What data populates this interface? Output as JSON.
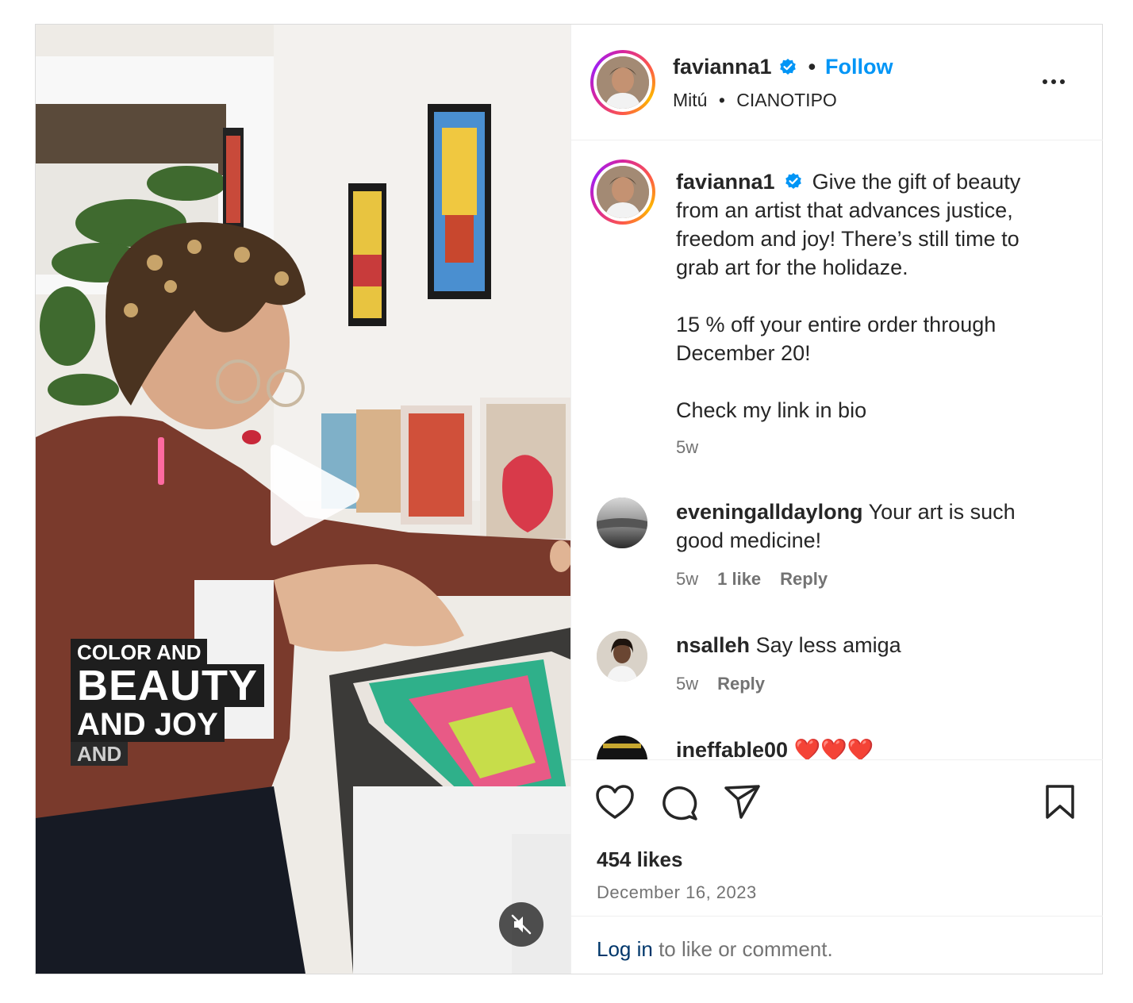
{
  "media": {
    "overlay_lines": [
      "COLOR AND",
      "BEAUTY",
      "AND JOY",
      "AND"
    ]
  },
  "header": {
    "username": "favianna1",
    "separator": "•",
    "follow_label": "Follow",
    "audio_artist": "Mitú",
    "audio_sep": "•",
    "audio_track": "CIANOTIPO"
  },
  "caption": {
    "username": "favianna1",
    "text1": "Give the gift of beauty from an artist that advances justice, freedom and joy! There’s still time to grab art for the holidaze.",
    "text2": "15 % off your entire order through December 20!",
    "text3": "Check my link in bio",
    "time": "5w"
  },
  "comments": [
    {
      "username": "eveningalldaylong",
      "text": "Your art is such good medicine!",
      "time": "5w",
      "likes": "1 like",
      "reply": "Reply"
    },
    {
      "username": "nsalleh",
      "text": "Say less amiga",
      "time": "5w",
      "reply": "Reply"
    },
    {
      "username": "ineffable00",
      "text": "❤️❤️❤️"
    }
  ],
  "footer": {
    "likes": "454 likes",
    "date": "December 16, 2023",
    "login_link": "Log in",
    "login_rest": " to like or comment."
  },
  "colors": {
    "accent": "#0095f6",
    "text": "#262626",
    "muted": "#737373",
    "border": "#dbdbdb"
  },
  "icons": [
    "verified-icon",
    "more-icon",
    "play-icon",
    "mute-icon",
    "heart-icon",
    "comment-icon",
    "share-icon",
    "bookmark-icon"
  ]
}
